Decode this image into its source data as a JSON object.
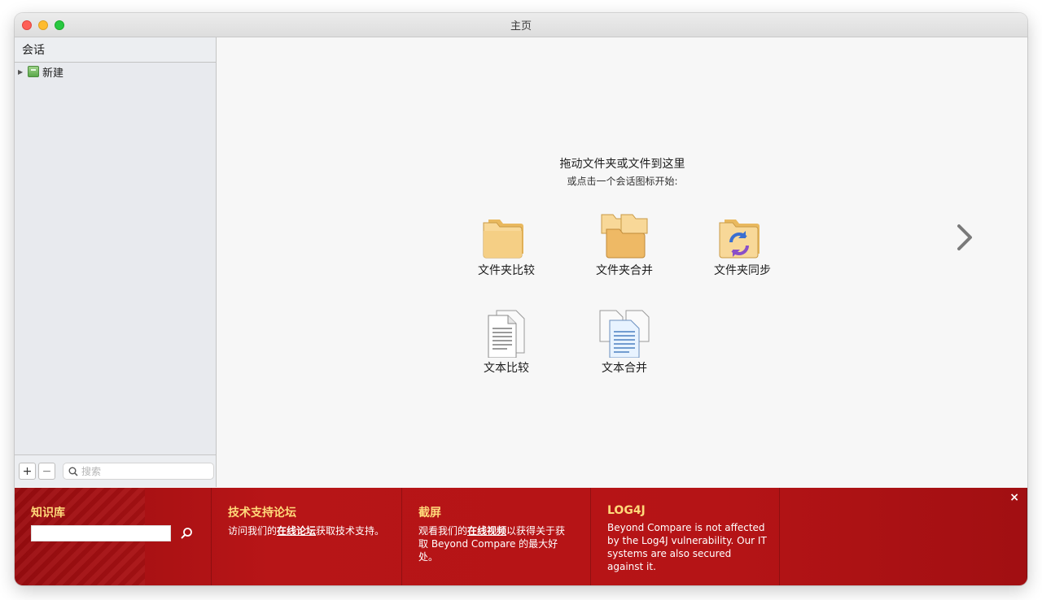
{
  "window": {
    "title": "主页"
  },
  "sidebar": {
    "header": "会话",
    "items": [
      {
        "label": "新建",
        "expanded": false
      }
    ],
    "footer": {
      "add_label": "+",
      "remove_label": "−",
      "search_placeholder": "搜索"
    }
  },
  "main": {
    "drop_hint": "拖动文件夹或文件到这里",
    "click_hint": "或点击一个会话图标开始:",
    "sessions": [
      {
        "label": "文件夹比较",
        "icon": "folder-compare-icon"
      },
      {
        "label": "文件夹合并",
        "icon": "folder-merge-icon"
      },
      {
        "label": "文件夹同步",
        "icon": "folder-sync-icon"
      },
      {
        "label": "文本比较",
        "icon": "text-compare-icon"
      },
      {
        "label": "文本合并",
        "icon": "text-merge-icon"
      }
    ],
    "next_icon": "chevron-right-icon"
  },
  "banner": {
    "knowledge_base": {
      "title": "知识库",
      "search_value": ""
    },
    "forum": {
      "title": "技术支持论坛",
      "text_before": "访问我们的",
      "link": "在线论坛",
      "text_after": "获取技术支持。"
    },
    "screenshots": {
      "title": "截屏",
      "text_before": "观看我们的",
      "link": "在线视频",
      "text_after": "以获得关于获取 Beyond Compare 的最大好处。"
    },
    "log4j": {
      "title": "LOG4J",
      "text": "Beyond Compare is not affected by the Log4J vulnerability. Our IT systems are also secured against it."
    },
    "close_label": "×"
  },
  "colors": {
    "banner_bg": "#b51416",
    "banner_title": "#ffd97a",
    "folder": "#f3c97a"
  }
}
